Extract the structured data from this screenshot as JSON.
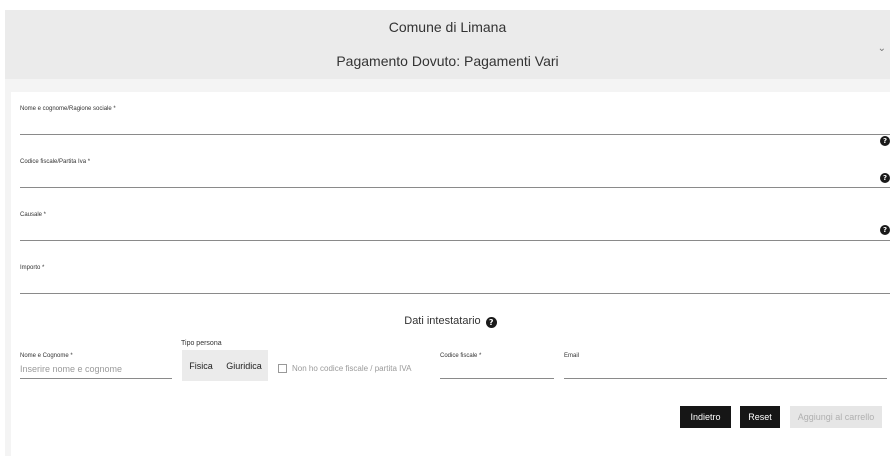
{
  "header": {
    "title": "Comune di Limana",
    "subtitle": "Pagamento Dovuto: Pagamenti Vari"
  },
  "form": {
    "fields": [
      {
        "label": "Nome e cognome/Ragione sociale *",
        "value": ""
      },
      {
        "label": "Codice fiscale/Partita Iva *",
        "value": ""
      },
      {
        "label": "Causale *",
        "value": ""
      },
      {
        "label": "Importo *",
        "value": ""
      }
    ],
    "help_icon": "question-circle-icon"
  },
  "intestatario": {
    "title": "Dati intestatario",
    "nome": {
      "label": "Nome e Cognome *",
      "placeholder": "Inserire nome e cognome"
    },
    "tipo_persona": {
      "label": "Tipo persona",
      "options": [
        "Fisica",
        "Giuridica"
      ],
      "selected": "Fisica"
    },
    "no_cf": {
      "label": "Non ho codice fiscale / partita IVA",
      "checked": false
    },
    "codice_fiscale": {
      "label": "Codice fiscale *",
      "value": ""
    },
    "email": {
      "label": "Email",
      "value": ""
    }
  },
  "actions": {
    "back": "Indietro",
    "reset": "Reset",
    "add_to_cart": "Aggiungi al carrello"
  },
  "colors": {
    "dark_button": "#161616",
    "header_bg": "#ebebeb"
  }
}
